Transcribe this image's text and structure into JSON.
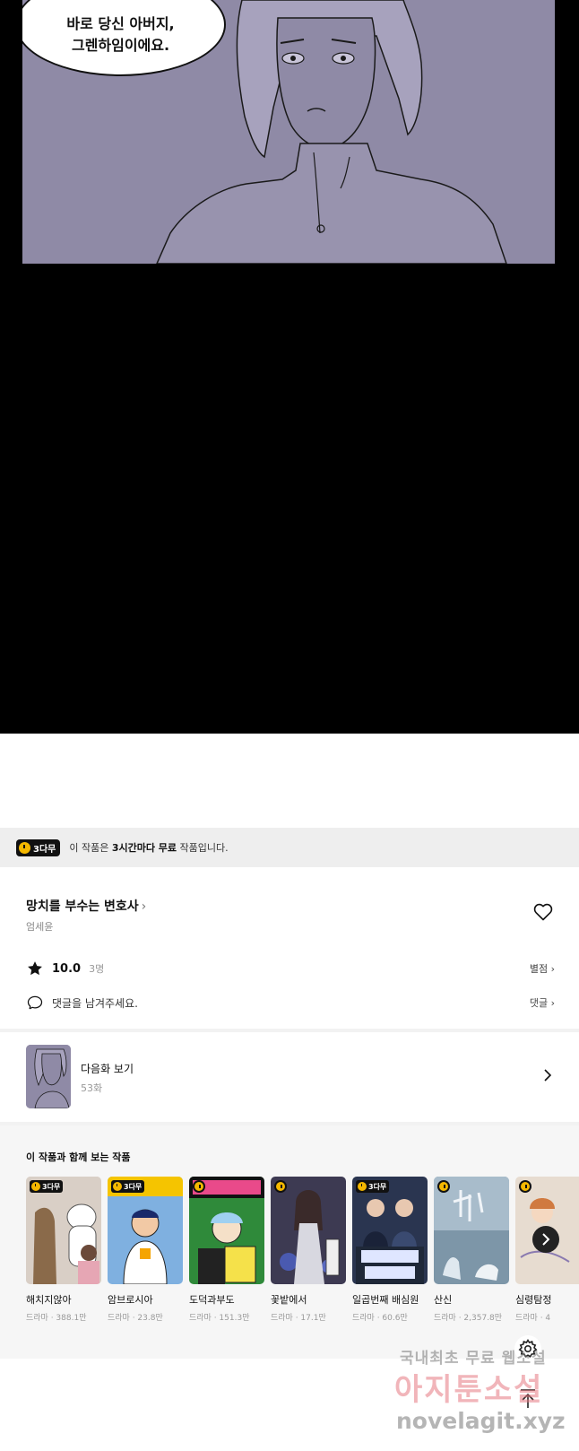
{
  "comic": {
    "speech_line1": "바로 당신 아버지,",
    "speech_line2": "그렌하임이에요."
  },
  "free_banner": {
    "badge": "3다무",
    "text_prefix": "이 작품은 ",
    "text_bold": "3시간마다 무료",
    "text_suffix": " 작품입니다."
  },
  "series": {
    "title": "망치를 부수는 변호사",
    "author": "엄세윤"
  },
  "rating": {
    "value": "10.0",
    "count": "3명",
    "link": "별점"
  },
  "comments": {
    "prompt": "댓글을 남겨주세요.",
    "link": "댓글"
  },
  "next_episode": {
    "label": "다음화 보기",
    "episode": "53화"
  },
  "recommendations": {
    "title": "이 작품과 함께 보는 작품",
    "items": [
      {
        "name": "해치지않아",
        "meta": "드라마 · 388.1만",
        "badge": "3다무",
        "cover_color": "#d9cfc6"
      },
      {
        "name": "암브로시아",
        "meta": "드라마 · 23.8만",
        "badge": "3다무",
        "cover_color": "#7fb0e0"
      },
      {
        "name": "도덕과부도",
        "meta": "드라마 · 151.3만",
        "badge": "",
        "cover_color": "#2f8a3a"
      },
      {
        "name": "꽃밭에서",
        "meta": "드라마 · 17.1만",
        "badge": "",
        "cover_color": "#3d3a52"
      },
      {
        "name": "일곱번째 배심원",
        "meta": "드라마 · 60.6만",
        "badge": "3다무",
        "cover_color": "#2a3550"
      },
      {
        "name": "산신",
        "meta": "드라마 · 2,357.8만",
        "badge": "",
        "cover_color": "#7d96a8"
      },
      {
        "name": "심령탐정",
        "meta": "드라마 · 4",
        "badge": "",
        "cover_color": "#e7dcd0"
      }
    ]
  },
  "watermark": {
    "line1": "국내최초 무료 웹소설",
    "line2": "아지툰소설",
    "line3": "novelagit.xyz"
  }
}
